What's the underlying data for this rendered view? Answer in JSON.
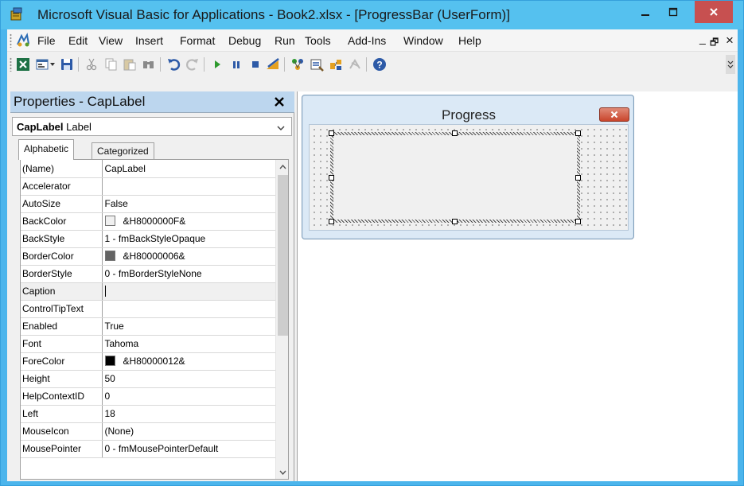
{
  "window": {
    "title": "Microsoft Visual Basic for Applications - Book2.xlsx - [ProgressBar (UserForm)]"
  },
  "menu": {
    "items": [
      "File",
      "Edit",
      "View",
      "Insert",
      "Format",
      "Debug",
      "Run",
      "Tools",
      "Add-Ins",
      "Window",
      "Help"
    ],
    "mdi_minimize": "_",
    "mdi_restore": "🗗",
    "mdi_close": "×"
  },
  "properties": {
    "title": "Properties - CapLabel",
    "object_name": "CapLabel",
    "object_type": " Label",
    "tabs": {
      "alphabetic": "Alphabetic",
      "categorized": "Categorized"
    },
    "rows": [
      {
        "name": "(Name)",
        "value": "CapLabel"
      },
      {
        "name": "Accelerator",
        "value": ""
      },
      {
        "name": "AutoSize",
        "value": "False"
      },
      {
        "name": "BackColor",
        "value": "&H8000000F&",
        "swatch": "#f0f0f0"
      },
      {
        "name": "BackStyle",
        "value": "1 - fmBackStyleOpaque"
      },
      {
        "name": "BorderColor",
        "value": "&H80000006&",
        "swatch": "#646464"
      },
      {
        "name": "BorderStyle",
        "value": "0 - fmBorderStyleNone"
      },
      {
        "name": "Caption",
        "value": ""
      },
      {
        "name": "ControlTipText",
        "value": ""
      },
      {
        "name": "Enabled",
        "value": "True"
      },
      {
        "name": "Font",
        "value": "Tahoma"
      },
      {
        "name": "ForeColor",
        "value": "&H80000012&",
        "swatch": "#000000"
      },
      {
        "name": "Height",
        "value": "50"
      },
      {
        "name": "HelpContextID",
        "value": "0"
      },
      {
        "name": "Left",
        "value": "18"
      },
      {
        "name": "MouseIcon",
        "value": "(None)"
      },
      {
        "name": "MousePointer",
        "value": "0 - fmMousePointerDefault"
      }
    ]
  },
  "userform": {
    "caption": "Progress"
  },
  "colors": {
    "titlebar": "#55c1ef",
    "panel_header": "#bcd6ee",
    "close_button": "#c75050"
  }
}
